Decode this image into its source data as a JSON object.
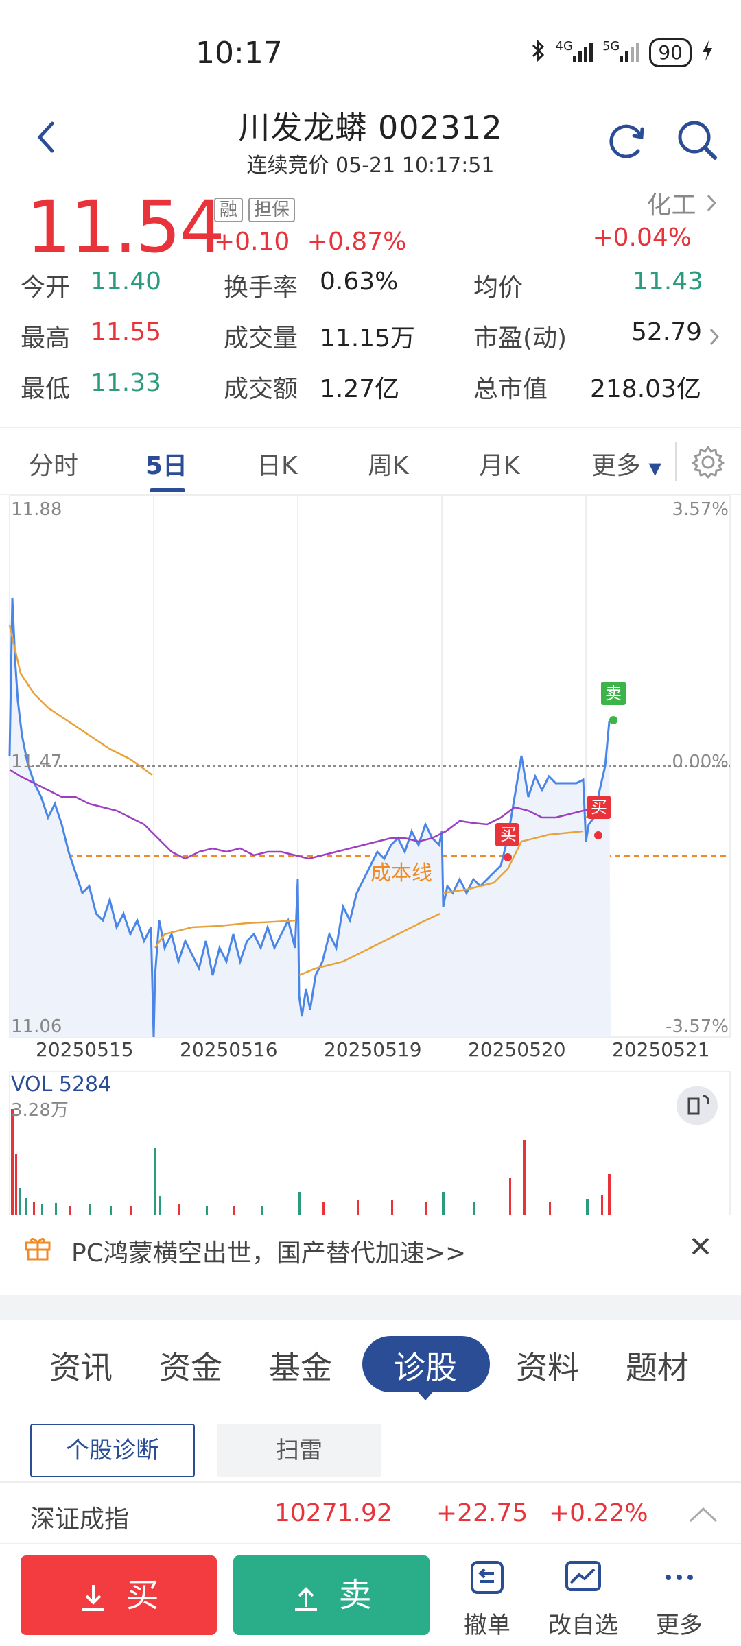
{
  "status": {
    "time": "10:17",
    "net1": "4G",
    "net2": "5G",
    "battery": "90"
  },
  "header": {
    "title": "川发龙蟒 002312",
    "subtitle": "连续竞价 05-21 10:17:51"
  },
  "quote": {
    "price": "11.54",
    "tag_rong": "融",
    "tag_danbao": "担保",
    "change": "+0.10",
    "change_pct": "+0.87%",
    "sector": "化工",
    "sector_pct": "+0.04%",
    "stats": [
      [
        {
          "label": "今开",
          "value": "11.40"
        },
        {
          "label": "换手率",
          "value": "0.63%"
        },
        {
          "label": "均价",
          "value": "11.43"
        }
      ],
      [
        {
          "label": "最高",
          "value": "11.55"
        },
        {
          "label": "成交量",
          "value": "11.15万"
        },
        {
          "label": "市盈(动)",
          "value": "52.79"
        }
      ],
      [
        {
          "label": "最低",
          "value": "11.33"
        },
        {
          "label": "成交额",
          "value": "1.27亿"
        },
        {
          "label": "总市值",
          "value": "218.03亿"
        }
      ]
    ]
  },
  "tabs": [
    "分时",
    "5日",
    "日K",
    "周K",
    "月K",
    "更多"
  ],
  "active_tab": "5日",
  "chart": {
    "y_top": "11.88",
    "y_mid": "11.47",
    "y_bottom": "11.06",
    "pct_top": "3.57%",
    "pct_mid": "0.00%",
    "pct_bottom": "-3.57%",
    "dates": [
      "20250515",
      "20250516",
      "20250519",
      "20250520",
      "20250521"
    ],
    "cost_line_label": "成本线",
    "marker_buy": "买",
    "marker_sell": "卖",
    "vol_label": "VOL 5284",
    "vol_max": "3.28万"
  },
  "banner": {
    "text": "PC鸿蒙横空出世，国产替代加速>>"
  },
  "subtabs": [
    "资讯",
    "资金",
    "基金",
    "诊股",
    "资料",
    "题材"
  ],
  "active_subtab": "诊股",
  "diag_buttons": {
    "primary": "个股诊断",
    "secondary": "扫雷"
  },
  "index": {
    "name": "深证成指",
    "value": "10271.92",
    "change": "+22.75",
    "pct": "+0.22%"
  },
  "bottom": {
    "buy": "买",
    "sell": "卖",
    "cancel": "撤单",
    "edit_watch": "改自选",
    "more": "更多"
  },
  "colors": {
    "up": "#e8333b",
    "down": "#2b9a7d",
    "accent": "#2a4d96",
    "price_line": "#4a86e8",
    "avg_line": "#e8a23a",
    "index_line": "#9c3fc2"
  }
}
